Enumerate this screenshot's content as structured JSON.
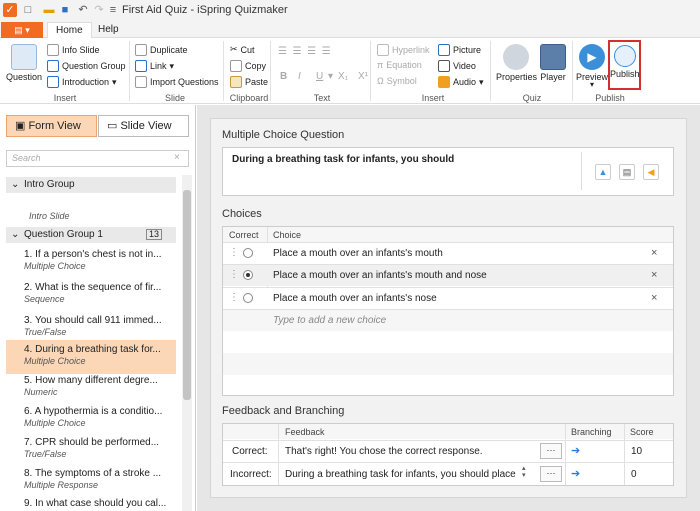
{
  "window": {
    "title": "First Aid Quiz - iSpring Quizmaker"
  },
  "tabs": {
    "home": "Home",
    "help": "Help"
  },
  "ribbon": {
    "insert": {
      "question": "Question",
      "info_slide": "Info Slide",
      "question_group": "Question Group",
      "introduction": "Introduction",
      "label": "Insert"
    },
    "slide": {
      "duplicate": "Duplicate",
      "link": "Link",
      "import_questions": "Import Questions",
      "label": "Slide"
    },
    "clipboard": {
      "cut": "Cut",
      "copy": "Copy",
      "paste": "Paste",
      "label": "Clipboard"
    },
    "text": {
      "bold": "B",
      "italic": "I",
      "underline": "U",
      "sub": "X₁",
      "sup": "X¹",
      "label": "Text"
    },
    "insert2": {
      "hyperlink": "Hyperlink",
      "equation": "Equation",
      "symbol": "Symbol",
      "picture": "Picture",
      "video": "Video",
      "audio": "Audio",
      "label": "Insert"
    },
    "quiz": {
      "properties": "Properties",
      "player": "Player",
      "label": "Quiz"
    },
    "publish": {
      "preview": "Preview",
      "publish": "Publish",
      "label": "Publish"
    }
  },
  "left": {
    "form_view": "Form View",
    "slide_view": "Slide View",
    "search_placeholder": "Search",
    "groups": [
      {
        "name": "Intro Group"
      },
      {
        "name": "Question Group 1",
        "count": "13"
      }
    ],
    "intro_slide": "Intro Slide",
    "items": [
      {
        "title": "1. If a person's chest is not in...",
        "type": "Multiple Choice"
      },
      {
        "title": "2. What is the sequence of fir...",
        "type": "Sequence"
      },
      {
        "title": "3. You should call 911 immed...",
        "type": "True/False"
      },
      {
        "title": "4. During a breathing task for...",
        "type": "Multiple Choice"
      },
      {
        "title": "5. How many different degre...",
        "type": "Numeric"
      },
      {
        "title": "6. A hypothermia is a conditio...",
        "type": "Multiple Choice"
      },
      {
        "title": "7. CPR should be performed...",
        "type": "True/False"
      },
      {
        "title": "8. The symptoms of a stroke ...",
        "type": "Multiple Response"
      },
      {
        "title": "9. In what case should you cal...",
        "type": ""
      }
    ]
  },
  "main": {
    "section_title": "Multiple Choice Question",
    "question": "During a breathing task for infants, you should",
    "choices_title": "Choices",
    "choices_headers": {
      "correct": "Correct",
      "choice": "Choice"
    },
    "choices": [
      {
        "text": "Place a mouth over an infants's mouth",
        "correct": false
      },
      {
        "text": "Place a mouth over an infants's mouth and nose",
        "correct": true
      },
      {
        "text": "Place a mouth over an infants's nose",
        "correct": false
      }
    ],
    "new_choice_placeholder": "Type to add a new choice",
    "feedback_title": "Feedback and Branching",
    "feedback_headers": {
      "feedback": "Feedback",
      "branching": "Branching",
      "score": "Score"
    },
    "feedback": [
      {
        "label": "Correct:",
        "text": "That's right! You chose the correct response.",
        "score": "10"
      },
      {
        "label": "Incorrect:",
        "text": "During a breathing task for infants, you should place a",
        "score": "0"
      }
    ]
  },
  "colors": {
    "accent": "#f16c22",
    "selected": "#fbd7b8",
    "publish_border": "#d32f2f"
  }
}
